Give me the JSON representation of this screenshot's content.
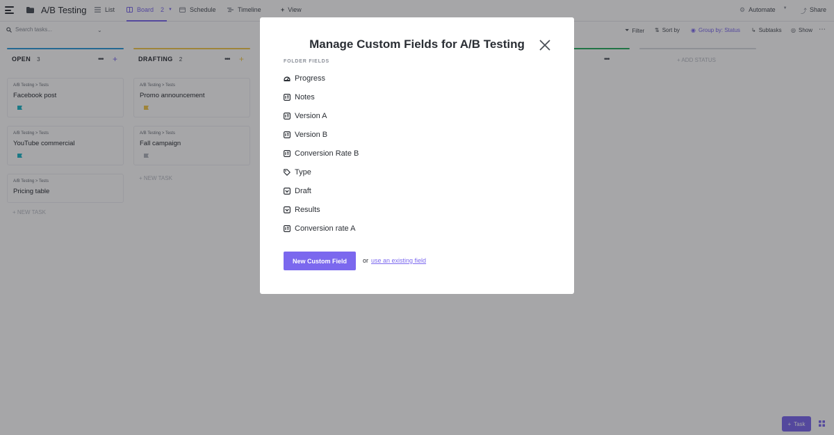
{
  "header": {
    "app_title": "A/B Testing",
    "tabs": [
      {
        "label": "List",
        "icon": "list-icon"
      },
      {
        "label": "Board",
        "count": "2",
        "icon": "board-icon"
      },
      {
        "label": "Schedule",
        "icon": "calendar-icon"
      },
      {
        "label": "Timeline",
        "icon": "timeline-icon"
      }
    ],
    "add_view_label": "View",
    "automate_label": "Automate",
    "share_label": "Share"
  },
  "toolbar": {
    "search_placeholder": "Search tasks...",
    "filter_label": "Filter",
    "sort_label": "Sort by",
    "group_label": "Group by: Status",
    "subtasks_label": "Subtasks",
    "show_label": "Show"
  },
  "board": {
    "columns": [
      {
        "name": "OPEN",
        "count": "3",
        "color": "#2d9cdb",
        "cards": [
          {
            "crumb": "A/B Testing  >  Tests",
            "title": "Facebook post",
            "flag_color": "#1fb6c8"
          },
          {
            "crumb": "A/B Testing  >  Tests",
            "title": "YouTube commercial",
            "flag_color": "#1fb6c8"
          },
          {
            "crumb": "A/B Testing  >  Tests",
            "title": "Pricing table",
            "flag_color": ""
          }
        ],
        "new_task_label": "+ NEW TASK"
      },
      {
        "name": "DRAFTING",
        "count": "2",
        "color": "#f2c94c",
        "cards": [
          {
            "crumb": "A/B Testing  >  Tests",
            "title": "Promo announcement",
            "flag_color": "#f2c94c"
          },
          {
            "crumb": "A/B Testing  >  Tests",
            "title": "Fall campaign",
            "flag_color": "#b0b5bd"
          }
        ],
        "new_task_label": "+ NEW TASK"
      }
    ],
    "add_status_label": "+ ADD STATUS"
  },
  "modal": {
    "title": "Manage Custom Fields for A/B Testing",
    "section_label": "FOLDER FIELDS",
    "fields": [
      {
        "label": "Progress",
        "icon": "progress-icon"
      },
      {
        "label": "Notes",
        "icon": "text-field-icon"
      },
      {
        "label": "Version A",
        "icon": "text-field-icon"
      },
      {
        "label": "Version B",
        "icon": "text-field-icon"
      },
      {
        "label": "Conversion Rate B",
        "icon": "text-field-icon"
      },
      {
        "label": "Type",
        "icon": "tag-icon"
      },
      {
        "label": "Draft",
        "icon": "dropdown-field-icon"
      },
      {
        "label": "Results",
        "icon": "dropdown-field-icon"
      },
      {
        "label": "Conversion rate A",
        "icon": "text-field-icon"
      }
    ],
    "new_field_button": "New Custom Field",
    "or_text": "or",
    "existing_link": "use an existing field"
  },
  "footer": {
    "task_button": "Task"
  },
  "colors": {
    "accent": "#7b68ee",
    "overlay": "rgba(20,20,26,0.38)"
  }
}
